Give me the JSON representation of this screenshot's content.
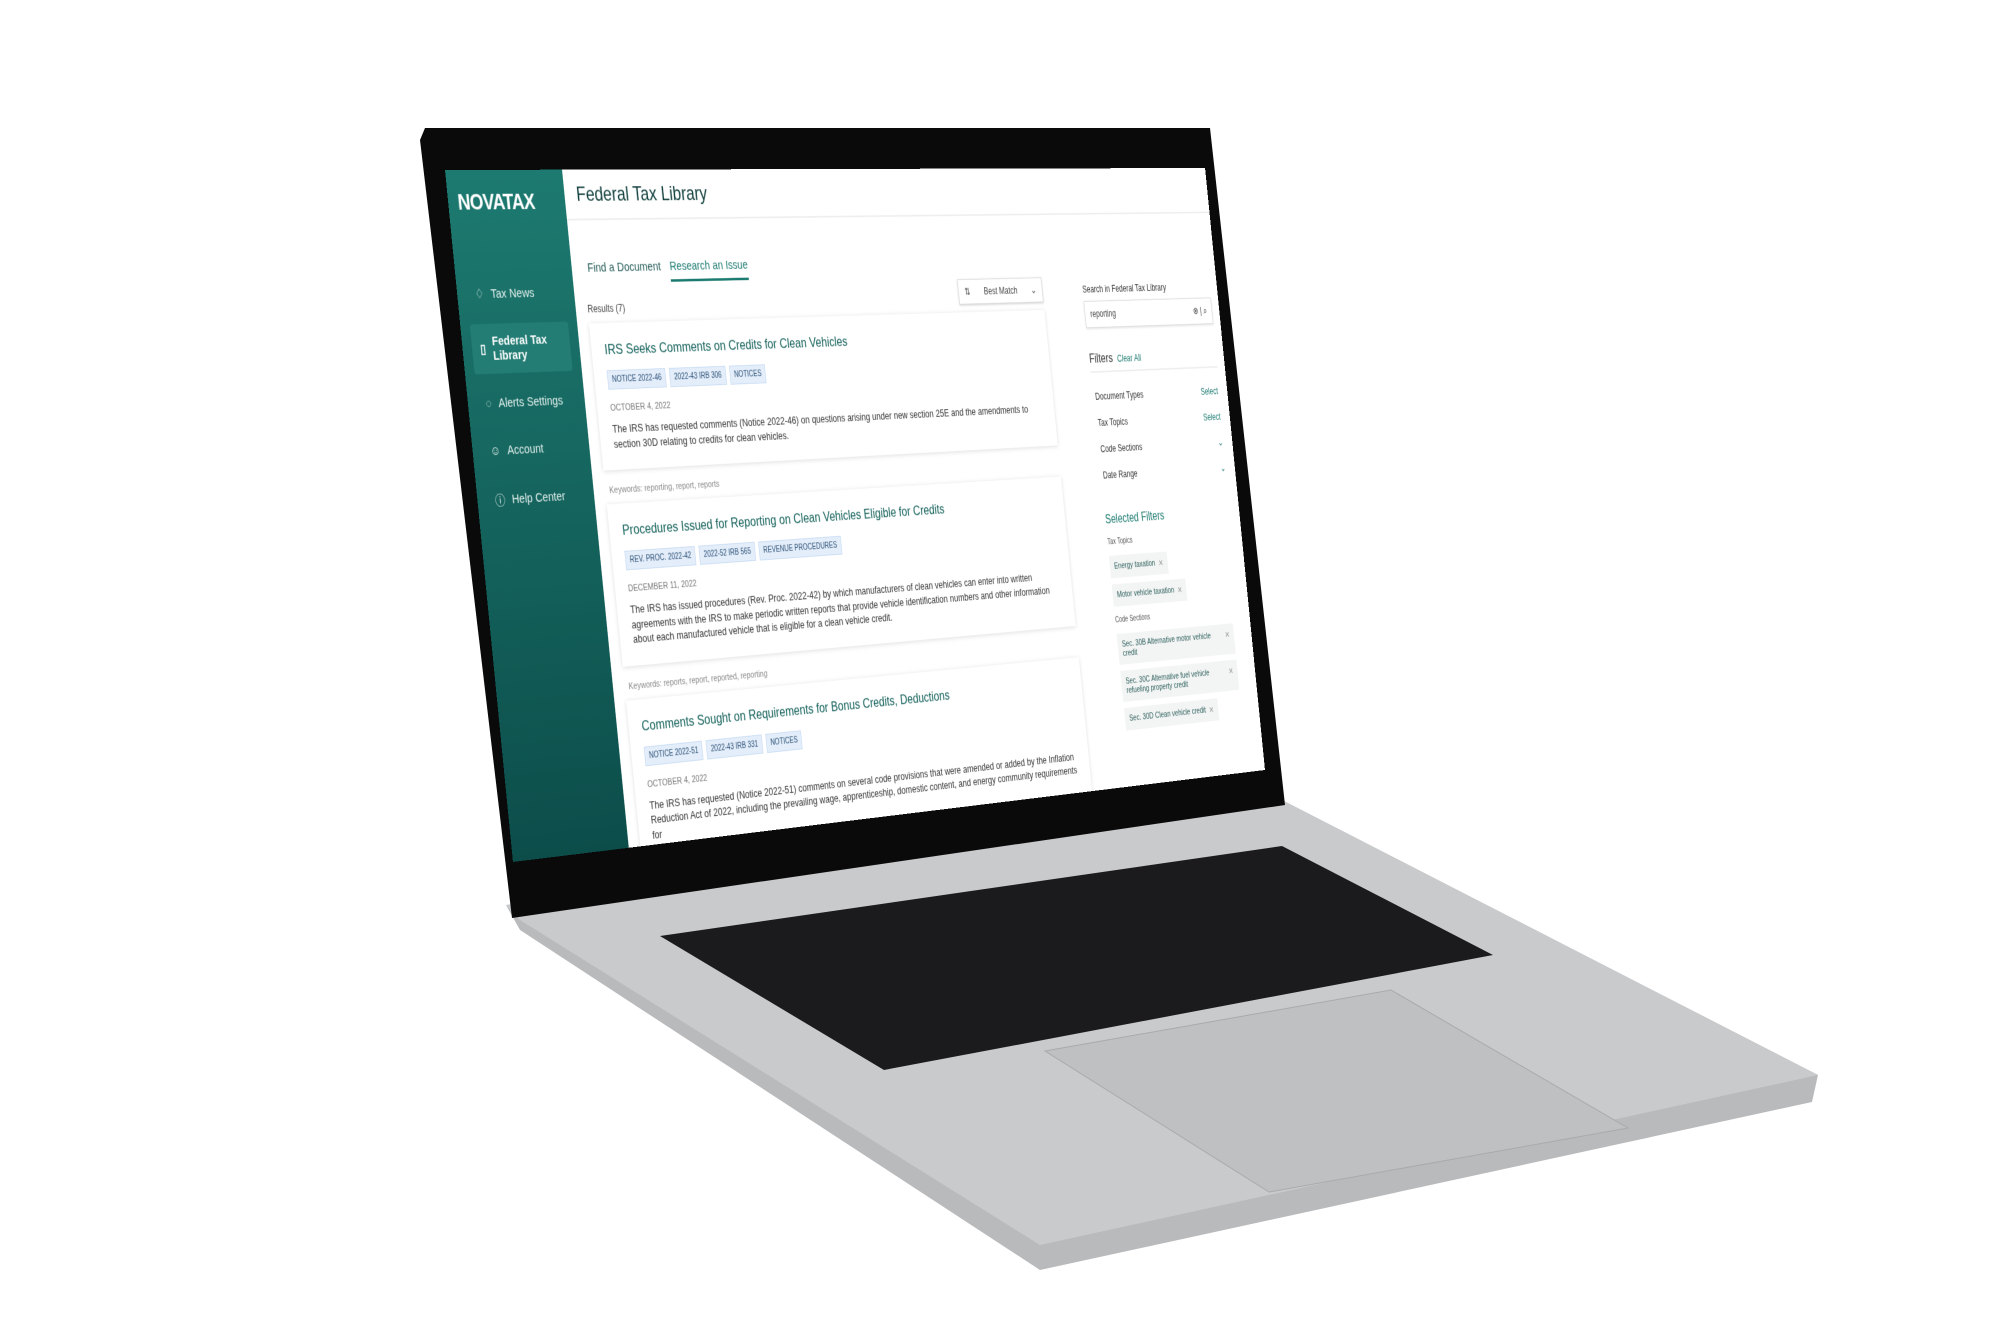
{
  "app": {
    "logo": "NOVATAX",
    "page_title": "Federal Tax Library"
  },
  "sidebar": {
    "items": [
      {
        "label": "Tax News",
        "icon": "bell-icon"
      },
      {
        "label": "Federal Tax Library",
        "icon": "document-icon",
        "active": true
      },
      {
        "label": "Alerts Settings",
        "icon": "bell-icon"
      },
      {
        "label": "Account",
        "icon": "user-icon"
      },
      {
        "label": "Help Center",
        "icon": "question-icon"
      }
    ]
  },
  "tabs": [
    {
      "label": "Find a Document"
    },
    {
      "label": "Research an Issue",
      "active": true
    }
  ],
  "results": {
    "count_label": "Results (7)",
    "sort_label": "Best Match",
    "items": [
      {
        "title": "IRS Seeks Comments on Credits for Clean Vehicles",
        "tags": [
          "NOTICE 2022-46",
          "2022-43 IRB 306",
          "NOTICES"
        ],
        "date": "OCTOBER 4, 2022",
        "desc": "The IRS has requested comments (Notice 2022-46) on questions arising under new section 25E and the amendments to section 30D relating to credits for clean vehicles.",
        "keywords": "Keywords: reporting, report, reports"
      },
      {
        "title": "Procedures Issued for Reporting on Clean Vehicles Eligible for Credits",
        "tags": [
          "REV. PROC. 2022-42",
          "2022-52 IRB 565",
          "REVENUE PROCEDURES"
        ],
        "date": "DECEMBER 11, 2022",
        "desc": "The IRS has issued procedures (Rev. Proc. 2022-42) by which manufacturers of clean vehicles can enter into written agreements with the IRS to make periodic written reports that provide vehicle identification numbers and other information about each manufactured vehicle that is eligible for a clean vehicle credit.",
        "keywords": "Keywords: reports, report, reported, reporting"
      },
      {
        "title": "Comments Sought on Requirements for Bonus Credits, Deductions",
        "tags": [
          "NOTICE 2022-51",
          "2022-43 IRB 331",
          "NOTICES"
        ],
        "date": "OCTOBER 4, 2022",
        "desc": "The IRS has requested (Notice 2022-51) comments on several code provisions that were amended or added by the Inflation Reduction Act of 2022, including the prevailing wage, apprenticeship, domestic content, and energy community requirements for",
        "keywords": ""
      }
    ]
  },
  "search": {
    "label": "Search in Federal Tax Library",
    "value": "reporting"
  },
  "filters": {
    "title": "Filters",
    "clear_all": "Clear All",
    "rows": [
      {
        "label": "Document Types",
        "action": "Select"
      },
      {
        "label": "Tax Topics",
        "action": "Select"
      },
      {
        "label": "Code Sections",
        "action": "⌄"
      },
      {
        "label": "Date Range",
        "action": "⌄"
      }
    ],
    "selected_title": "Selected Filters",
    "groups": [
      {
        "label": "Tax Topics",
        "chips": [
          "Energy taxation",
          "Motor vehicle taxation"
        ]
      },
      {
        "label": "Code Sections",
        "chips": [
          "Sec. 30B Alternative motor vehicle credit",
          "Sec. 30C Alternative fuel vehicle refueling property credit",
          "Sec. 30D Clean vehicle credit"
        ]
      }
    ]
  },
  "colors": {
    "brand": "#1b7b70",
    "sidebar_dark": "#0c4d4a"
  }
}
